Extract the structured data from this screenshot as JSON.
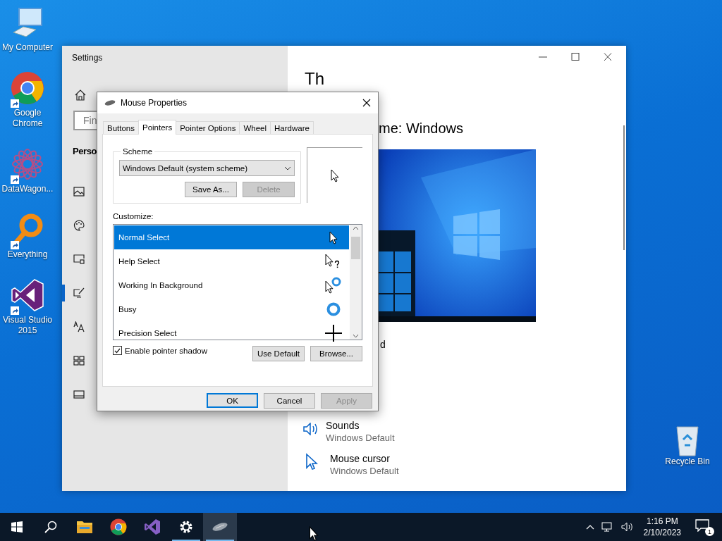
{
  "desktop": {
    "icons": [
      {
        "kind": "computer",
        "label": "My Computer",
        "shortcut": false
      },
      {
        "kind": "chrome",
        "label": "Google Chrome",
        "shortcut": true
      },
      {
        "kind": "datawagon",
        "label": "DataWagon...",
        "shortcut": true
      },
      {
        "kind": "everything",
        "label": "Everything",
        "shortcut": true
      },
      {
        "kind": "visualstudio",
        "label": "Visual Studio 2015",
        "shortcut": true
      }
    ],
    "recycle_bin": {
      "label": "Recycle Bin"
    }
  },
  "settings": {
    "title": "Settings",
    "search": {
      "placeholder": "Fin"
    },
    "section": "Perso",
    "nav": [
      {
        "kind": "picture",
        "selected": false
      },
      {
        "kind": "palette",
        "selected": false
      },
      {
        "kind": "lockscreen",
        "selected": false
      },
      {
        "kind": "themes",
        "selected": true
      },
      {
        "kind": "fonts",
        "selected": false
      },
      {
        "kind": "start",
        "selected": false
      },
      {
        "kind": "taskbar",
        "selected": false
      }
    ],
    "heading": "Th",
    "theme_label": "me: Windows",
    "fragment": "d",
    "rows": [
      {
        "kind": "sound",
        "title": "Sounds",
        "value": "Windows Default"
      },
      {
        "kind": "cursor",
        "title": "Mouse cursor",
        "value": "Windows Default"
      }
    ]
  },
  "dialog": {
    "title": "Mouse Properties",
    "tabs": [
      {
        "label": "Buttons",
        "selected": false
      },
      {
        "label": "Pointers",
        "selected": true
      },
      {
        "label": "Pointer Options",
        "selected": false
      },
      {
        "label": "Wheel",
        "selected": false
      },
      {
        "label": "Hardware",
        "selected": false
      }
    ],
    "scheme": {
      "legend": "Scheme",
      "value": "Windows Default (system scheme)",
      "buttons": [
        {
          "label": "Save As...",
          "disabled": false
        },
        {
          "label": "Delete",
          "disabled": true
        }
      ]
    },
    "customize_label": "Customize:",
    "pointers": [
      {
        "label": "Normal Select",
        "kind": "arrow",
        "selected": true
      },
      {
        "label": "Help Select",
        "kind": "help",
        "selected": false
      },
      {
        "label": "Working In Background",
        "kind": "working",
        "selected": false
      },
      {
        "label": "Busy",
        "kind": "busy",
        "selected": false
      },
      {
        "label": "Precision Select",
        "kind": "precision",
        "selected": false
      }
    ],
    "shadow": {
      "label": "Enable pointer shadow",
      "checked": true
    },
    "list_buttons": [
      {
        "label": "Use Default",
        "disabled": false
      },
      {
        "label": "Browse...",
        "disabled": false
      }
    ],
    "footer_buttons": [
      {
        "label": "OK",
        "default": true,
        "disabled": false
      },
      {
        "label": "Cancel",
        "default": false,
        "disabled": false
      },
      {
        "label": "Apply",
        "default": false,
        "disabled": true
      }
    ]
  },
  "taskbar": {
    "apps": [
      {
        "kind": "start",
        "running": false,
        "selected": false
      },
      {
        "kind": "search",
        "running": false,
        "selected": false
      },
      {
        "kind": "explorer",
        "running": false,
        "selected": false
      },
      {
        "kind": "chrome",
        "running": false,
        "selected": false
      },
      {
        "kind": "visualstudio",
        "running": false,
        "selected": false
      },
      {
        "kind": "settings",
        "running": true,
        "selected": false
      },
      {
        "kind": "mouse",
        "running": true,
        "selected": true
      }
    ],
    "time": "1:16 PM",
    "date": "2/10/2023",
    "notifications": "1"
  }
}
